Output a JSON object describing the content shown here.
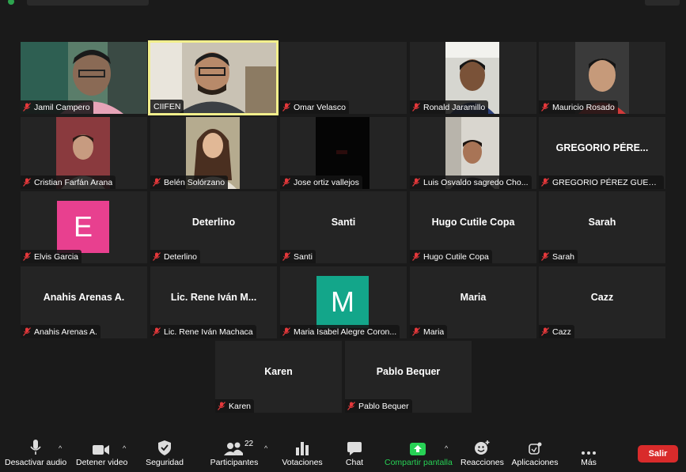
{
  "participants": [
    {
      "name": "Jamil Campero"
    },
    {
      "name": "CIIFEN"
    },
    {
      "name": "Omar Velasco"
    },
    {
      "name": "Ronald Jaramillo"
    },
    {
      "name": "Mauricio Rosado"
    },
    {
      "name": "Cristian Farfán Arana"
    },
    {
      "name": "Belén Solórzano"
    },
    {
      "name": "Jose ortiz vallejos"
    },
    {
      "name": "Luis Osvaldo sagredo Cho..."
    },
    {
      "name": "GREGORIO PÉREZ GUERRE...",
      "display": "GREGORIO PÉRE..."
    },
    {
      "name": "Elvis Garcia",
      "initial": "E",
      "color": "#e8408f"
    },
    {
      "name": "Deterlino",
      "display": "Deterlino"
    },
    {
      "name": "Santi",
      "display": "Santi"
    },
    {
      "name": "Hugo Cutile Copa",
      "display": "Hugo Cutile Copa"
    },
    {
      "name": "Sarah",
      "display": "Sarah"
    },
    {
      "name": "Anahis Arenas A.",
      "display": "Anahis Arenas A."
    },
    {
      "name": "Lic. Rene Iván Machaca",
      "display": "Lic. Rene Iván M..."
    },
    {
      "name": "Maria Isabel Alegre Coron...",
      "initial": "M",
      "color": "#13a68a"
    },
    {
      "name": "Maria",
      "display": "Maria"
    },
    {
      "name": "Cazz",
      "display": "Cazz"
    },
    {
      "name": "Karen",
      "display": "Karen"
    },
    {
      "name": "Pablo Bequer",
      "display": "Pablo Bequer"
    }
  ],
  "toolbar": {
    "audio": "Desactivar audio",
    "video": "Detener video",
    "security": "Seguridad",
    "participants": "Participantes",
    "participants_count": "22",
    "polls": "Votaciones",
    "chat": "Chat",
    "share": "Compartir pantalla",
    "reactions": "Reacciones",
    "apps": "Aplicaciones",
    "more": "Más",
    "leave": "Salir"
  },
  "colors": {
    "active_speaker_border": "#f2ef8c",
    "share_green": "#27d155",
    "leave_red": "#d92b2b",
    "muted_red": "#e5383b"
  }
}
